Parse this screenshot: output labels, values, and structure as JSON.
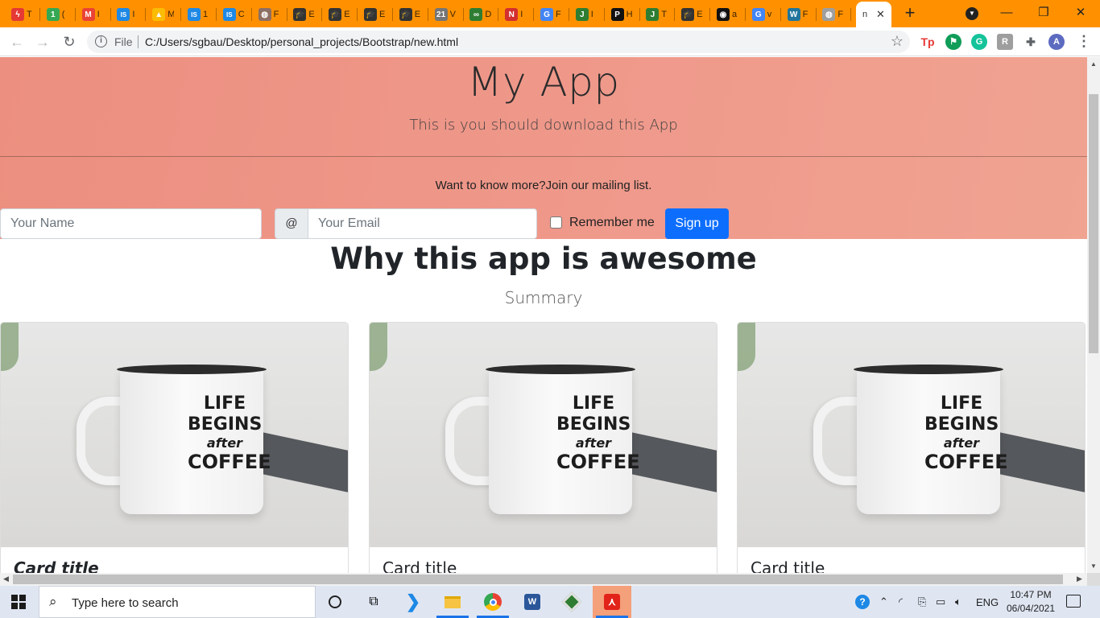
{
  "browser": {
    "tabs": [
      {
        "title": "T",
        "icon": "lightning-icon",
        "color": "#e53935",
        "glyph": "ϟ"
      },
      {
        "title": "(",
        "icon": "one-icon",
        "color": "#34a853",
        "glyph": "1"
      },
      {
        "title": "I",
        "icon": "gmail-icon",
        "color": "#ea4335",
        "glyph": "M"
      },
      {
        "title": "I",
        "icon": "is-icon",
        "color": "#1e88e5",
        "glyph": "IS"
      },
      {
        "title": "M",
        "icon": "drive-icon",
        "color": "#fbbc04",
        "glyph": "▲"
      },
      {
        "title": "1",
        "icon": "is-icon",
        "color": "#1e88e5",
        "glyph": "IS"
      },
      {
        "title": "C",
        "icon": "is-icon",
        "color": "#1e88e5",
        "glyph": "IS"
      },
      {
        "title": "F",
        "icon": "globe-icon",
        "color": "#8d6e63",
        "glyph": "◍"
      },
      {
        "title": "E",
        "icon": "graduation-cap-icon",
        "color": "#333333",
        "glyph": "🎓"
      },
      {
        "title": "E",
        "icon": "graduation-cap-icon",
        "color": "#333333",
        "glyph": "🎓"
      },
      {
        "title": "E",
        "icon": "graduation-cap-icon",
        "color": "#333333",
        "glyph": "🎓"
      },
      {
        "title": "E",
        "icon": "graduation-cap-icon",
        "color": "#333333",
        "glyph": "🎓"
      },
      {
        "title": "V",
        "icon": "calendar-icon",
        "color": "#757575",
        "glyph": "21"
      },
      {
        "title": "D",
        "icon": "infinity-icon",
        "color": "#2e7d32",
        "glyph": "∞"
      },
      {
        "title": "I",
        "icon": "netflix-icon",
        "color": "#d32f2f",
        "glyph": "N"
      },
      {
        "title": "F",
        "icon": "google-icon",
        "color": "#4285f4",
        "glyph": "G"
      },
      {
        "title": "I",
        "icon": "j-icon",
        "color": "#2e7d32",
        "glyph": "J"
      },
      {
        "title": "H",
        "icon": "p-icon",
        "color": "#111111",
        "glyph": "P"
      },
      {
        "title": "T",
        "icon": "j-icon",
        "color": "#2e7d32",
        "glyph": "J"
      },
      {
        "title": "E",
        "icon": "graduation-cap-icon",
        "color": "#333333",
        "glyph": "🎓"
      },
      {
        "title": "a",
        "icon": "github-icon",
        "color": "#111111",
        "glyph": "◉"
      },
      {
        "title": "v",
        "icon": "google-icon",
        "color": "#4285f4",
        "glyph": "G"
      },
      {
        "title": "F",
        "icon": "wordpress-icon",
        "color": "#21759b",
        "glyph": "W"
      },
      {
        "title": "F",
        "icon": "globe-icon",
        "color": "#9e9e9e",
        "glyph": "◍"
      }
    ],
    "active_tab": {
      "title": "n",
      "close": "✕"
    },
    "new_tab": "+",
    "window": {
      "minimize": "—",
      "maximize": "❐",
      "close": "✕"
    },
    "nav": {
      "back": "←",
      "forward": "→",
      "reload": "↻"
    },
    "address": {
      "scheme_label": "File",
      "url": "C:/Users/sgbau/Desktop/personal_projects/Bootstrap/new.html",
      "star": "☆"
    },
    "extensions": [
      {
        "glyph": "Tp",
        "icon": "tp-extension-icon",
        "color": "#e53935"
      },
      {
        "glyph": "⚑",
        "icon": "green-flag-extension-icon",
        "color": "#0f9d58"
      },
      {
        "glyph": "G",
        "icon": "grammarly-icon",
        "color": "#15c39a"
      },
      {
        "glyph": "R",
        "icon": "r-extension-icon",
        "color": "#9e9e9e"
      },
      {
        "glyph": "✚",
        "icon": "puzzle-icon",
        "color": "#5f6368"
      },
      {
        "glyph": "A",
        "icon": "avatar",
        "color": "#5c6bc0"
      }
    ],
    "menu": "⋮"
  },
  "page": {
    "title": "My App",
    "lead": "This is you should download this App",
    "mailing_text": "Want to know more?Join our mailing list.",
    "name_placeholder": "Your Name",
    "email_addon": "@",
    "email_placeholder": "Your Email",
    "remember_label": "Remember me",
    "signup_label": "Sign up",
    "section_title": "Why this app is awesome",
    "section_subtitle": "Summary",
    "mug_text": [
      "LIFE",
      "BEGINS",
      "after",
      "COFFEE"
    ],
    "cards": [
      {
        "title": "Card title"
      },
      {
        "title": "Card title"
      },
      {
        "title": "Card title"
      }
    ]
  },
  "taskbar": {
    "search_placeholder": "Type here to search",
    "language": "ENG",
    "time": "10:47 PM",
    "date": "06/04/2021"
  }
}
